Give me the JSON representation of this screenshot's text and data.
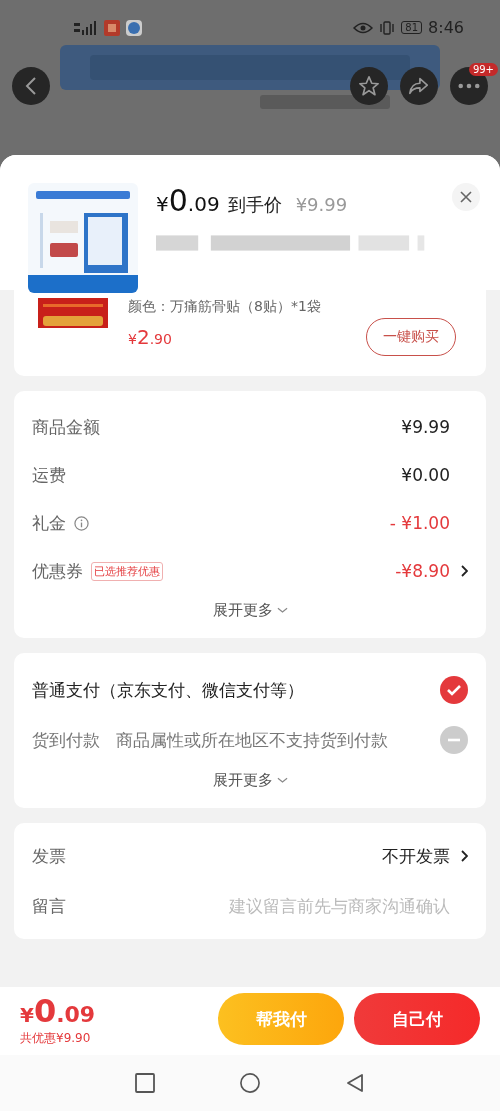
{
  "status_bar": {
    "time": "8:46",
    "battery": "81"
  },
  "top_actions": {
    "badge": "99+"
  },
  "sheet": {
    "price": {
      "currency": "¥",
      "integer": "0",
      "decimal": ".09"
    },
    "price_label": "到手价",
    "original_price": "¥9.99"
  },
  "recommended_item": {
    "spec": "颜色：万痛筋骨贴（8贴）*1袋",
    "price": {
      "currency": "¥",
      "integer": "2",
      "decimal": ".90"
    },
    "button": "一键购买"
  },
  "fees": [
    {
      "label": "商品金额",
      "value": "¥9.99",
      "discount": false,
      "info": false,
      "arrow": false
    },
    {
      "label": "运费",
      "value": "¥0.00",
      "discount": false,
      "info": false,
      "arrow": false
    },
    {
      "label": "礼金",
      "value": "- ¥1.00",
      "discount": true,
      "info": true,
      "arrow": false
    },
    {
      "label": "优惠券",
      "tag": "已选推荐优惠",
      "value": "-¥8.90",
      "discount": true,
      "info": false,
      "arrow": true
    }
  ],
  "fees_more": "展开更多",
  "payments": [
    {
      "label": "普通支付（京东支付、微信支付等）",
      "selected": true,
      "disabled": false
    },
    {
      "label": "货到付款",
      "note": "商品属性或所在地区不支持货到付款",
      "selected": false,
      "disabled": true
    }
  ],
  "payments_more": "展开更多",
  "extras": [
    {
      "label": "发票",
      "value": "不开发票",
      "arrow": true
    },
    {
      "label": "留言",
      "placeholder": "建议留言前先与商家沟通确认",
      "arrow": false
    }
  ],
  "bottom_bar": {
    "price": {
      "currency": "¥",
      "integer": "0",
      "decimal": ".09"
    },
    "saving": "共优惠¥9.90",
    "buttons": [
      {
        "label": "帮我付",
        "kind": "secondary"
      },
      {
        "label": "自己付",
        "kind": "primary"
      }
    ]
  }
}
